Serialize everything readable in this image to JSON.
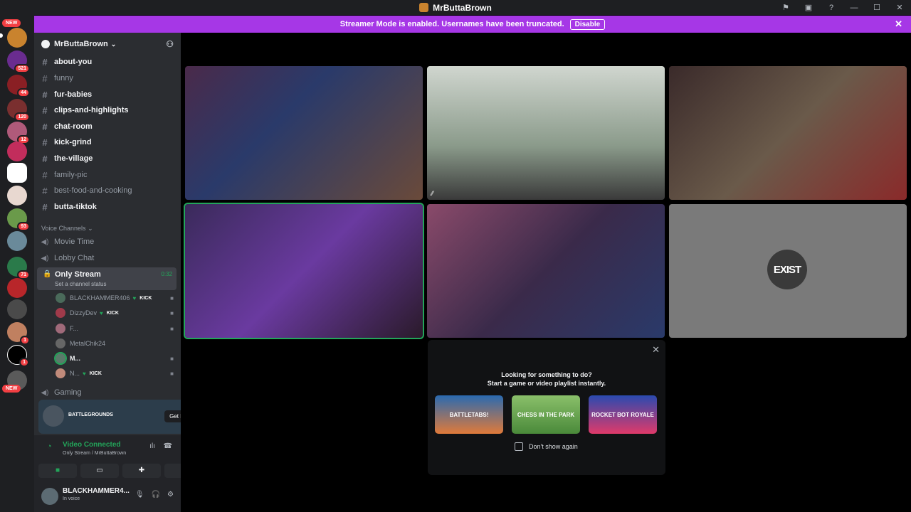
{
  "window": {
    "title": "MrButtaBrown"
  },
  "banner": {
    "text": "Streamer Mode is enabled. Usernames have been truncated.",
    "disable_label": "Disable"
  },
  "servers": {
    "badges": [
      "NEW",
      "521",
      "44",
      "120",
      "12",
      "93",
      "71",
      "1",
      "1",
      "NEW"
    ]
  },
  "guild": {
    "name": "MrButtaBrown"
  },
  "channels": [
    {
      "name": "about-you",
      "unread": true
    },
    {
      "name": "funny",
      "unread": false
    },
    {
      "name": "fur-babies",
      "unread": true
    },
    {
      "name": "clips-and-highlights",
      "unread": true
    },
    {
      "name": "chat-room",
      "unread": true
    },
    {
      "name": "kick-grind",
      "unread": true
    },
    {
      "name": "the-village",
      "unread": true
    },
    {
      "name": "family-pic",
      "unread": false
    },
    {
      "name": "best-food-and-cooking",
      "unread": false
    },
    {
      "name": "butta-tiktok",
      "unread": true
    }
  ],
  "voice": {
    "category": "Voice Channels",
    "channels": [
      "Movie Time",
      "Lobby Chat"
    ],
    "active": {
      "name": "Only Stream",
      "status": "Set a channel status",
      "timer": "0:32"
    },
    "members": [
      {
        "name": "BLACKHAMMER406",
        "tag": "KICK"
      },
      {
        "name": "DizzyDev",
        "tag": "KICK"
      },
      {
        "name": "F...",
        "tag": ""
      },
      {
        "name": "MetalChik24",
        "tag": ""
      },
      {
        "name": "M...",
        "tag": ""
      },
      {
        "name": "N...",
        "tag": "KICK"
      }
    ],
    "gaming": "Gaming"
  },
  "promo": {
    "game": "BATTLEGROUNDS",
    "button": "Get Reward!"
  },
  "rtc": {
    "status": "Video Connected",
    "location": "Only Stream / MrButtaBrown"
  },
  "user": {
    "name": "BLACKHAMMER4...",
    "status": "In voice"
  },
  "popup": {
    "line1": "Looking for something to do?",
    "line2": "Start a game or video playlist instantly.",
    "games": [
      "BATTLETABS!",
      "CHESS IN THE PARK",
      "ROCKET BOT ROYALE"
    ],
    "checkbox": "Don't show again"
  },
  "tiles": {
    "exist_logo": "EXIST"
  },
  "colors": {
    "banner": "#a637e6",
    "accent": "#23a55a",
    "sidebar": "#2b2d31"
  }
}
